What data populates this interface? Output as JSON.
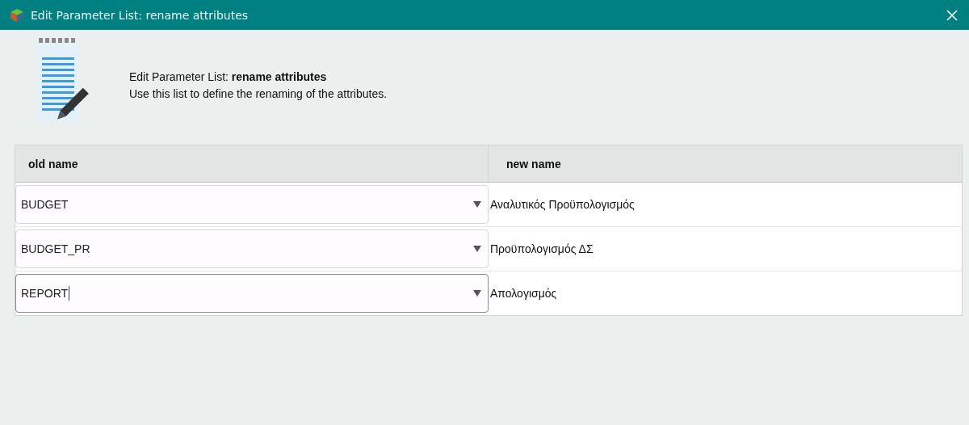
{
  "window": {
    "title": "Edit Parameter List: rename attributes"
  },
  "header": {
    "title": "Edit Parameter List: **rename attributes**",
    "description": "Use this list to define the renaming of the attributes."
  },
  "table": {
    "columns": [
      "old name",
      "new name"
    ],
    "rows": [
      {
        "old_name": "BUDGET",
        "new_name": "Αναλυτικός Προϋπολογισμός",
        "focused": false
      },
      {
        "old_name": "BUDGET_PR",
        "new_name": "Προϋπολογισμός ΔΣ",
        "focused": false
      },
      {
        "old_name": "REPORT",
        "new_name": "Απολογισμός",
        "focused": true
      }
    ]
  }
}
